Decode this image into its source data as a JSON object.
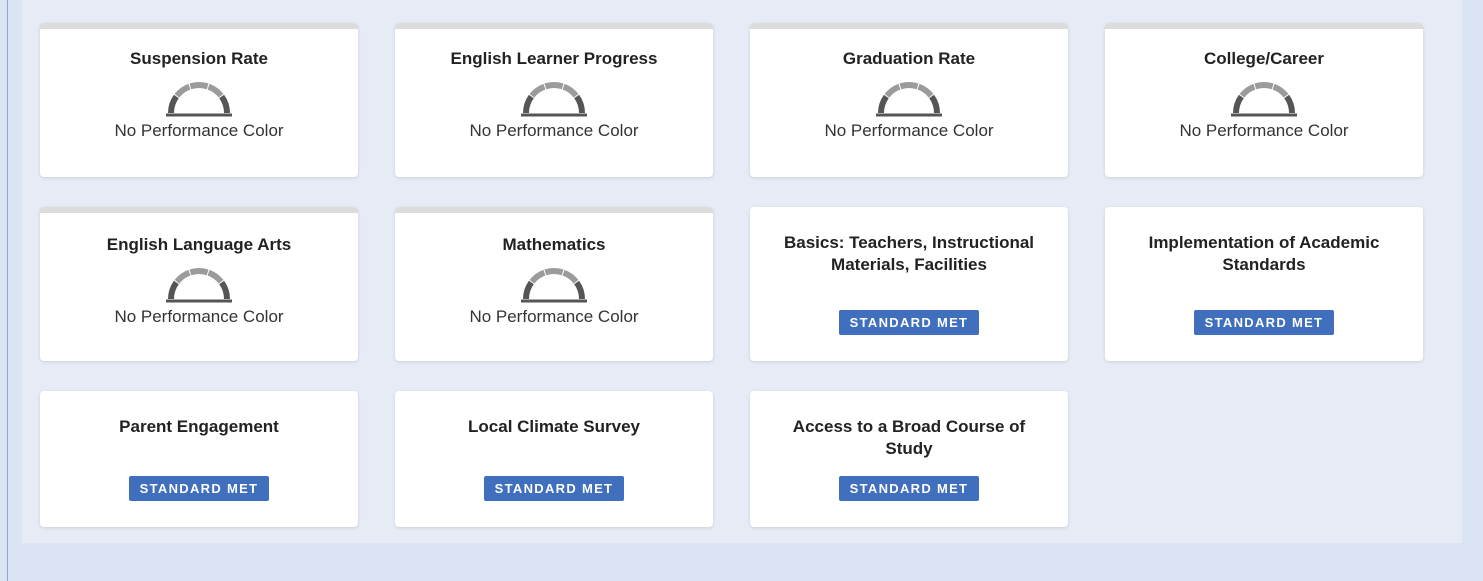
{
  "colors": {
    "page_bg": "#dbe4f3",
    "panel_bg": "#e6ebf5",
    "card_bg": "#ffffff",
    "badge_bg": "#3f6fbd",
    "gauge_dark": "#555555",
    "gauge_light": "#9b9b9b"
  },
  "cards": [
    {
      "title": "Suspension Rate",
      "type": "gauge",
      "status": "No Performance Color",
      "icon": "gauge-icon"
    },
    {
      "title": "English Learner Progress",
      "type": "gauge",
      "status": "No Performance Color",
      "icon": "gauge-icon"
    },
    {
      "title": "Graduation Rate",
      "type": "gauge",
      "status": "No Performance Color",
      "icon": "gauge-icon"
    },
    {
      "title": "College/Career",
      "type": "gauge",
      "status": "No Performance Color",
      "icon": "gauge-icon"
    },
    {
      "title": "English Language Arts",
      "type": "gauge",
      "status": "No Performance Color",
      "icon": "gauge-icon"
    },
    {
      "title": "Mathematics",
      "type": "gauge",
      "status": "No Performance Color",
      "icon": "gauge-icon"
    },
    {
      "title": "Basics: Teachers, Instructional Materials, Facilities",
      "type": "standard",
      "status": "STANDARD MET"
    },
    {
      "title": "Implementation of Academic Standards",
      "type": "standard",
      "status": "STANDARD MET"
    },
    {
      "title": "Parent Engagement",
      "type": "standard",
      "status": "STANDARD MET"
    },
    {
      "title": "Local Climate Survey",
      "type": "standard",
      "status": "STANDARD MET"
    },
    {
      "title": "Access to a Broad Course of Study",
      "type": "standard",
      "status": "STANDARD MET"
    }
  ]
}
